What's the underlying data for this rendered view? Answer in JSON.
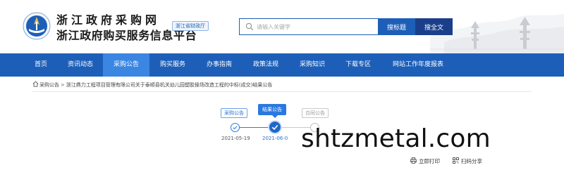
{
  "header": {
    "title_line1": "浙江政府采购网",
    "title_line2": "浙江政府购买服务信息平台",
    "badge": "浙江省财政厅"
  },
  "search": {
    "placeholder": "请输入关键字",
    "value": "",
    "btn_title": "搜标题",
    "btn_full": "搜全文"
  },
  "nav": {
    "items": [
      {
        "label": "首页",
        "active": false
      },
      {
        "label": "资讯动态",
        "active": false
      },
      {
        "label": "采购公告",
        "active": true
      },
      {
        "label": "购买服务",
        "active": false
      },
      {
        "label": "办事指南",
        "active": false
      },
      {
        "label": "政策法规",
        "active": false
      },
      {
        "label": "采购知识",
        "active": false
      },
      {
        "label": "下载专区",
        "active": false
      },
      {
        "label": "网站工作年度报表",
        "active": false
      }
    ]
  },
  "breadcrumb": {
    "home": "采购公告",
    "separator": ">",
    "current": "浙江鼎力工程项目管理有限公司关于泰顺县机关幼儿园塑胶操场改造工程的中标(成交)结果公告"
  },
  "progress": {
    "steps": [
      {
        "label": "采购公告",
        "date": "2021-05-19",
        "status": "done"
      },
      {
        "label": "结果公告",
        "date": "2021-06-0",
        "status": "current"
      },
      {
        "label": "合同公告",
        "date": "",
        "status": "pending"
      }
    ]
  },
  "actions": {
    "print": "立即打印",
    "share": "扫码分享"
  },
  "watermark": "shtzmetal.com",
  "colors": {
    "nav_bg": "#1d5fb8",
    "nav_active": "#3a86e2",
    "accent": "#2b78e0"
  }
}
